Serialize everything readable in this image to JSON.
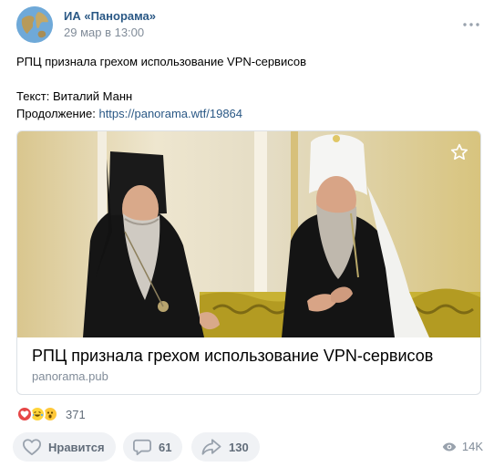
{
  "post": {
    "author": "ИА «Панорама»",
    "date": "29 мар в 13:00",
    "text": {
      "headline": "РПЦ признала грехом использование VPN-сервисов",
      "author_line": "Текст: Виталий Манн",
      "continuation_label": "Продолжение: ",
      "continuation_link": "https://panorama.wtf/19864"
    }
  },
  "attachment": {
    "title": "РПЦ признала грехом использование VPN-сервисов",
    "domain": "panorama.pub",
    "image_description_icon": "photo"
  },
  "reactions": {
    "icons": [
      "heart-reaction",
      "laughing-reaction",
      "surprised-reaction"
    ],
    "count": "371"
  },
  "actions": {
    "like_label": "Нравится",
    "comments_count": "61",
    "shares_count": "130",
    "views_count": "14K"
  },
  "colors": {
    "link": "#2a5885",
    "secondary_text": "#818c99",
    "button_bg": "#f0f2f5",
    "heart": "#e64646"
  }
}
